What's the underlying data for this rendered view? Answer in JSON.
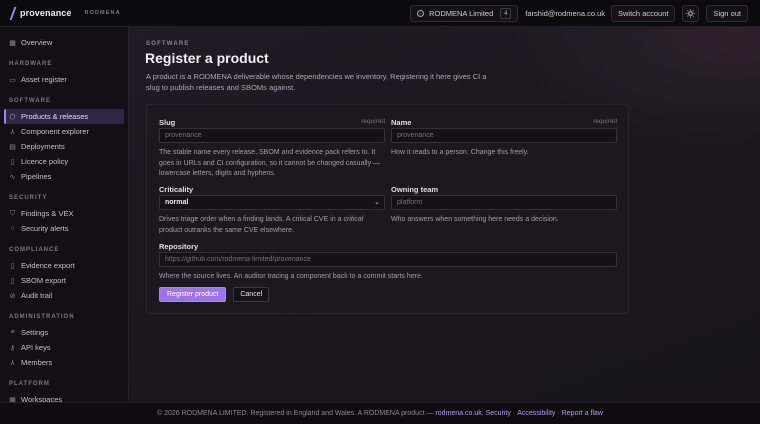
{
  "header": {
    "brand_name": "provenance",
    "brand_org": "RODMENA",
    "org_name": "RODMENA Limited",
    "org_count": "4",
    "user_email": "farshid@rodmena.co.uk",
    "switch_account": "Switch account",
    "theme_icon": "sun-icon",
    "sign_out": "Sign out"
  },
  "sidebar": {
    "sections": [
      {
        "label": "HARDWARE"
      },
      {
        "label": "SOFTWARE"
      },
      {
        "label": "SECURITY"
      },
      {
        "label": "COMPLIANCE"
      },
      {
        "label": "ADMINISTRATION"
      },
      {
        "label": "PLATFORM"
      }
    ],
    "items": [
      {
        "label": "Overview",
        "icon": "grid-icon"
      },
      {
        "label": "Asset register",
        "icon": "monitor-icon"
      },
      {
        "label": "Products & releases",
        "icon": "box-icon",
        "active": true
      },
      {
        "label": "Component explorer",
        "icon": "tree-icon"
      },
      {
        "label": "Deployments",
        "icon": "server-icon"
      },
      {
        "label": "Licence policy",
        "icon": "document-icon"
      },
      {
        "label": "Pipelines",
        "icon": "pulse-icon"
      },
      {
        "label": "Findings & VEX",
        "icon": "shield-icon"
      },
      {
        "label": "Security alerts",
        "icon": "alert-circle-icon"
      },
      {
        "label": "Evidence export",
        "icon": "file-icon"
      },
      {
        "label": "SBOM export",
        "icon": "file-icon"
      },
      {
        "label": "Audit trail",
        "icon": "link-icon"
      },
      {
        "label": "Settings",
        "icon": "sliders-icon"
      },
      {
        "label": "API keys",
        "icon": "key-icon"
      },
      {
        "label": "Members",
        "icon": "users-icon"
      },
      {
        "label": "Workspaces",
        "icon": "grid-icon"
      }
    ]
  },
  "main": {
    "eyebrow": "SOFTWARE",
    "title": "Register a product",
    "intro": "A product is a RODMENA deliverable whose dependencies we inventory. Registering it here gives CI a slug to publish releases and SBOMs against.",
    "form": {
      "slug": {
        "label": "Slug",
        "required": "required",
        "placeholder": "provenance",
        "hint": "The stable name every release, SBOM and evidence pack refers to. It goes in URLs and CI configuration, so it cannot be changed casually — lowercase letters, digits and hyphens."
      },
      "name": {
        "label": "Name",
        "required": "required",
        "placeholder": "provenance",
        "hint": "How it reads to a person. Change this freely."
      },
      "criticality": {
        "label": "Criticality",
        "value": "normal",
        "hint_before": "Drives triage order when a finding lands. A critical CVE in a ",
        "hint_em": "critical",
        "hint_after": " product outranks the same CVE elsewhere."
      },
      "owning_team": {
        "label": "Owning team",
        "placeholder": "platform",
        "hint": "Who answers when something here needs a decision."
      },
      "repository": {
        "label": "Repository",
        "placeholder": "https://github.com/rodmena-limited/provenance",
        "hint": "Where the source lives. An auditor tracing a component back to a commit starts here."
      },
      "submit": "Register product",
      "cancel": "Cancel"
    }
  },
  "footer": {
    "text": "© 2026 RODMENA LIMITED. Registered in England and Wales. A RODMENA product —",
    "site_link": "rodmena.co.uk.",
    "security": "Security",
    "accessibility": "Accessibility",
    "report": "Report a flaw"
  }
}
